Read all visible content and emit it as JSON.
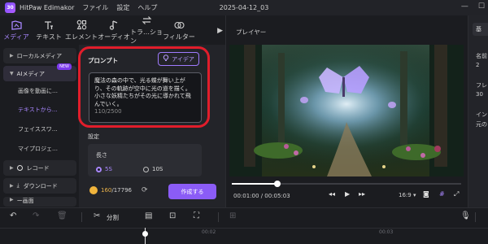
{
  "titlebar": {
    "app_name": "HitPaw Edimakor",
    "logo_text": "30",
    "menus": [
      "ファイル",
      "設定",
      "ヘルプ"
    ],
    "project_title": "2025-04-12_03"
  },
  "tool_tabs": [
    {
      "label": "メディア",
      "icon": "media-icon",
      "active": true
    },
    {
      "label": "テキスト",
      "icon": "text-icon",
      "active": false
    },
    {
      "label": "エレメント",
      "icon": "element-icon",
      "active": false
    },
    {
      "label": "オーディオ",
      "icon": "audio-icon",
      "active": false
    },
    {
      "label": "トラ…ション",
      "icon": "transition-icon",
      "active": false
    },
    {
      "label": "フィルター",
      "icon": "filter-icon",
      "active": false
    }
  ],
  "sidebar": {
    "local_media": "ローカルメディア",
    "ai_media": "AIメディア",
    "new_badge": "NEW",
    "sub_items": [
      "画像を動画に…",
      "テキストから…",
      "フェイススワ…",
      "マイプロジェ…"
    ],
    "record": "レコード",
    "download": "ダウンロード",
    "clipped": "ー画面"
  },
  "panel": {
    "prompt_label": "プロンプト",
    "idea_button": "アイデア",
    "prompt_text": "魔法の森の中で、光る蝶が舞い上がり、その軌跡が空中に光の道を描く。小さな妖精たちがその光に導かれて飛んでいく。",
    "prompt_count": "110/2500",
    "settings_label": "設定",
    "length_label": "長さ",
    "length_options": [
      "5S",
      "10S"
    ],
    "selected_length": "5S",
    "credits_current": "160",
    "credits_total": "/17796",
    "create_button": "作成する"
  },
  "player": {
    "label": "プレイヤー",
    "time_current": "00:01:00",
    "time_total": "/ 00:05:03",
    "progress": 0.2,
    "ratio": "16:9"
  },
  "right_panel": {
    "tab": "基",
    "rows": [
      "名前",
      "2",
      "フレ",
      "30",
      "イン",
      "元の"
    ]
  },
  "timeline": {
    "split_label": "分割",
    "ticks": [
      "00:02",
      "00:03"
    ]
  },
  "colors": {
    "accent": "#8b5cf6",
    "highlight_ring": "#e11d2b",
    "background": "#1b1c20"
  }
}
